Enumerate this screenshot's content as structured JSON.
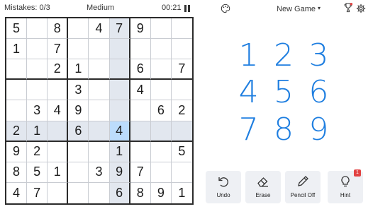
{
  "status": {
    "mistakes": "Mistakes: 0/3",
    "difficulty": "Medium",
    "timer": "00:21"
  },
  "header": {
    "new_game": "New Game",
    "dropdown_caret": "▾"
  },
  "board": {
    "rows": [
      [
        "5",
        "",
        "8",
        "",
        "4",
        "7",
        "9",
        "",
        ""
      ],
      [
        "1",
        "",
        "7",
        "",
        "",
        "",
        "",
        "",
        ""
      ],
      [
        "",
        "",
        "2",
        "1",
        "",
        "",
        "6",
        "",
        "7"
      ],
      [
        "",
        "",
        "",
        "3",
        "",
        "",
        "4",
        "",
        ""
      ],
      [
        "",
        "3",
        "4",
        "9",
        "",
        "",
        "",
        "6",
        "2"
      ],
      [
        "2",
        "1",
        "",
        "6",
        "",
        "4",
        "",
        "",
        ""
      ],
      [
        "9",
        "2",
        "",
        "",
        "",
        "1",
        "",
        "",
        "5"
      ],
      [
        "8",
        "5",
        "1",
        "",
        "3",
        "9",
        "7",
        "",
        ""
      ],
      [
        "4",
        "7",
        "",
        "",
        "",
        "6",
        "8",
        "9",
        "1"
      ]
    ],
    "selected": {
      "row": 5,
      "col": 5
    }
  },
  "numpad": [
    "1",
    "2",
    "3",
    "4",
    "5",
    "6",
    "7",
    "8",
    "9"
  ],
  "actions": {
    "undo": "Undo",
    "erase": "Erase",
    "pencil": "Pencil Off",
    "hint": "Hint",
    "hint_count": "1"
  },
  "icons": {
    "palette": "palette-icon",
    "trophy": "trophy-icon",
    "gear": "gear-icon",
    "pause": "pause-icon",
    "undo": "undo-icon",
    "erase": "eraser-icon",
    "pencil": "pencil-icon",
    "hint": "lightbulb-icon"
  },
  "colors": {
    "accent": "#1e7ee0",
    "highlight": "#e2e7ef",
    "selected": "#bcdcfb",
    "badge": "#e24242"
  }
}
